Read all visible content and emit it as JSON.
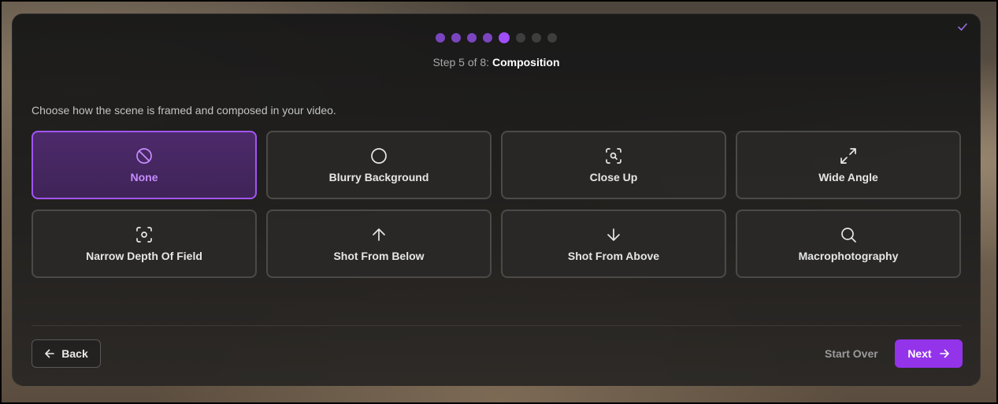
{
  "stepper": {
    "total": 8,
    "current": 5,
    "prefix": "Step 5 of 8:",
    "title": "Composition"
  },
  "description": "Choose how the scene is framed and composed in your video.",
  "options": [
    {
      "label": "None",
      "icon": "ban-icon",
      "selected": true
    },
    {
      "label": "Blurry Background",
      "icon": "circle-icon",
      "selected": false
    },
    {
      "label": "Close Up",
      "icon": "scan-search-icon",
      "selected": false
    },
    {
      "label": "Wide Angle",
      "icon": "expand-icon",
      "selected": false
    },
    {
      "label": "Narrow Depth Of Field",
      "icon": "focus-icon",
      "selected": false
    },
    {
      "label": "Shot From Below",
      "icon": "arrow-up-icon",
      "selected": false
    },
    {
      "label": "Shot From Above",
      "icon": "arrow-down-icon",
      "selected": false
    },
    {
      "label": "Macrophotography",
      "icon": "search-icon",
      "selected": false
    }
  ],
  "footer": {
    "back_label": "Back",
    "start_over_label": "Start Over",
    "next_label": "Next"
  },
  "colors": {
    "accent": "#9333ea",
    "accent_light": "#a04dfb",
    "selected_text": "#c58cff"
  }
}
